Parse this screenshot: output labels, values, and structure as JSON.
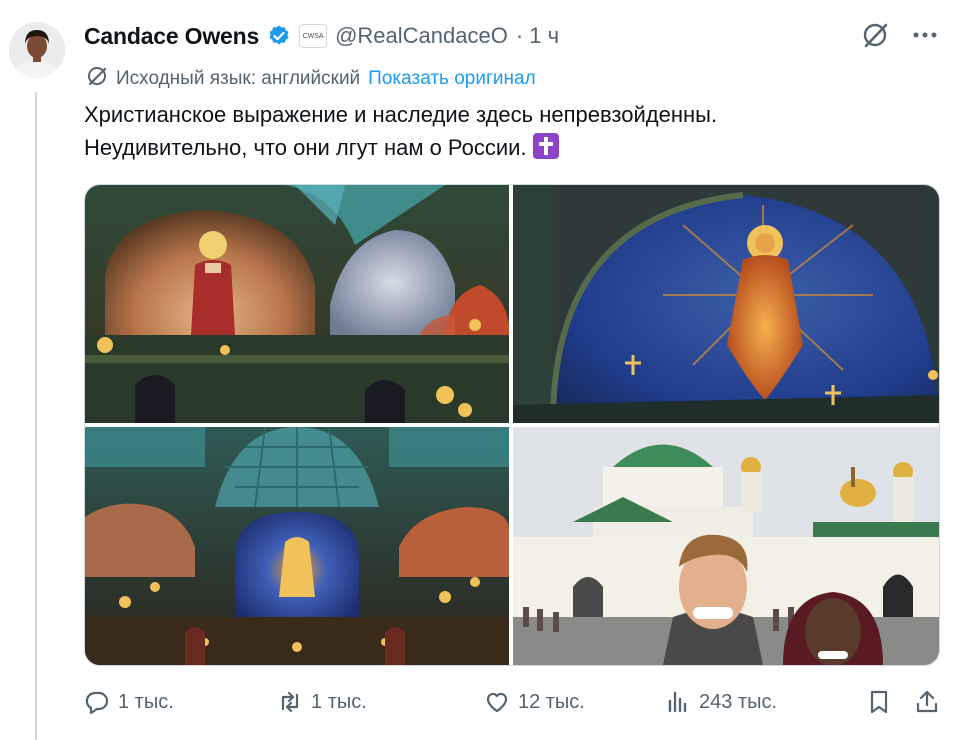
{
  "tweet": {
    "author_name": "Candace Owens",
    "affiliate_badge": "CWSA",
    "handle": "@RealCandaceO",
    "time": "· 1 ч",
    "translation_label": "Исходный язык: английский",
    "translation_link": "Показать оригинал",
    "text_line1": "Христианское выражение и наследие здесь непревзойденны.",
    "text_line2": "Неудивительно, что они лгут нам о России.",
    "emoji": "latin-cross-emoji"
  },
  "media": [
    {
      "name": "cathedral-interior-icon-photo"
    },
    {
      "name": "cathedral-dome-mosaic-photo"
    },
    {
      "name": "cathedral-nave-photo"
    },
    {
      "name": "monastery-selfie-photo"
    }
  ],
  "actions": {
    "replies": "1 тыс.",
    "reposts": "1 тыс.",
    "likes": "12 тыс.",
    "views": "243 тыс."
  },
  "colors": {
    "accent": "#1d9bf0",
    "secondary_text": "#536471",
    "primary_text": "#0f1419",
    "verified": "#1d9bf0"
  }
}
